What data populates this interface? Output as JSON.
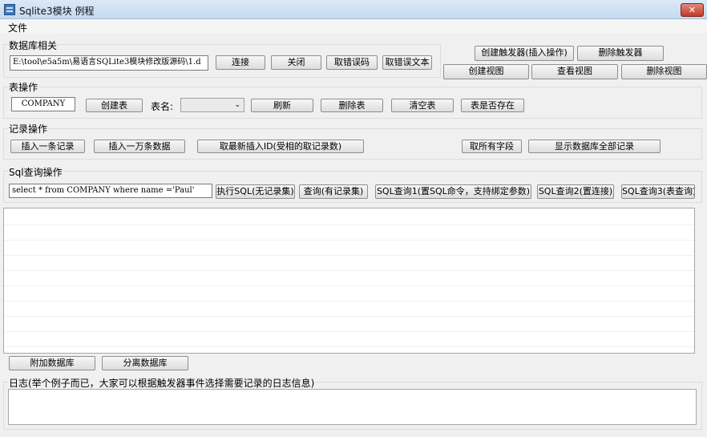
{
  "window": {
    "title": "Sqlite3模块 例程",
    "close_label": "✕"
  },
  "menu": {
    "file": "文件"
  },
  "db_group": {
    "title": "数据库相关",
    "path_value": "E:\\tool\\e5a5m\\易语言SQLite3模块修改版源码\\1.d",
    "connect": "连接",
    "close": "关闭",
    "errcode": "取错误码",
    "errtext": "取错误文本"
  },
  "trigger": {
    "create": "创建触发器(插入操作)",
    "delete": "删除触发器"
  },
  "view": {
    "create": "创建视图",
    "show": "查看视图",
    "delete": "删除视图"
  },
  "table_group": {
    "title": "表操作",
    "name_value": "COMPANY",
    "create": "创建表",
    "table_label": "表名:",
    "refresh": "刷新",
    "delete": "删除表",
    "clear": "清空表",
    "exists": "表是否存在"
  },
  "record_group": {
    "title": "记录操作",
    "insert_one": "插入一条记录",
    "insert_many": "插入一万条数据",
    "last_id": "取最新插入ID(受相的取记录数)",
    "all_fields": "取所有字段",
    "show_all": "显示数据库全部记录"
  },
  "sql_group": {
    "title": "Sql查询操作",
    "query_value": "select * from COMPANY where name ='Paul'",
    "exec": "执行SQL(无记录集)",
    "query": "查询(有记录集)",
    "query1": "SQL查询1(置SQL命令，支持绑定参数)",
    "query2": "SQL查询2(置连接)",
    "query3": "SQL查询3(表查询)"
  },
  "bottom": {
    "attach": "附加数据库",
    "detach": "分离数据库",
    "log_title": "日志(举个例子而已，大家可以根据触发器事件选择需要记录的日志信息)"
  }
}
